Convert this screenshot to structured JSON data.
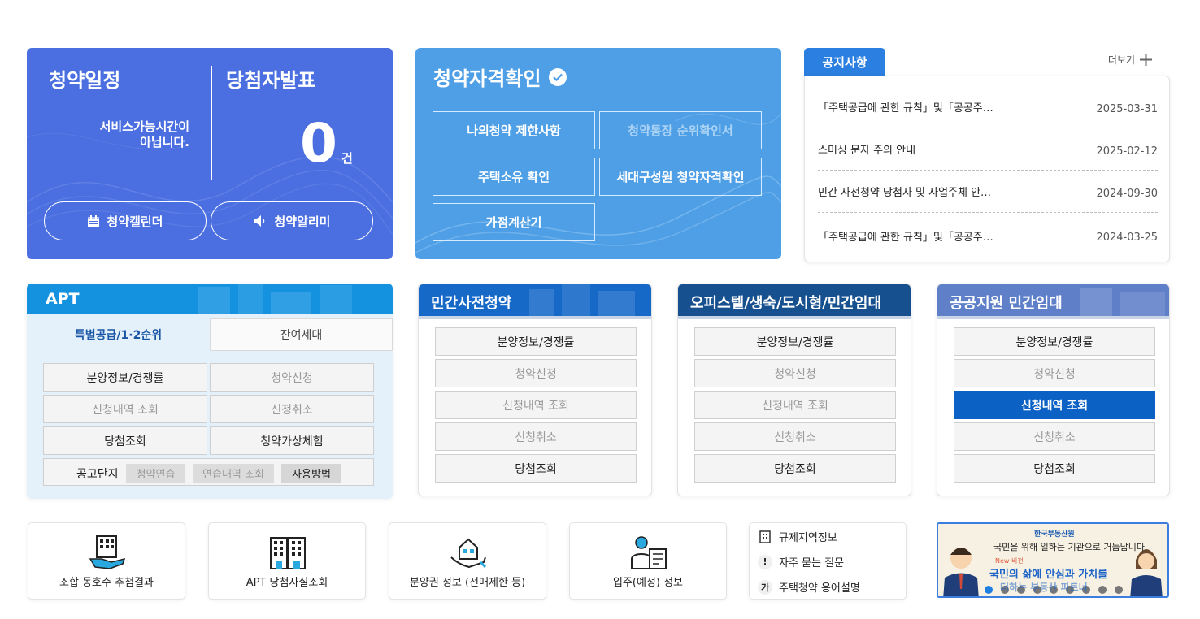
{
  "schedule": {
    "title_left": "청약일정",
    "title_right": "당첨자발표",
    "service_msg_1": "서비스가능시간이",
    "service_msg_2": "아닙니다.",
    "count": "0",
    "count_unit": "건",
    "calendar_label": "청약캘린더",
    "alarm_label": "청약알리미"
  },
  "qualification": {
    "title": "청약자격확인",
    "buttons": [
      "나의청약 제한사항",
      "청약통장 순위확인서",
      "주택소유 확인",
      "세대구성원 청약자격확인",
      "가점계산기"
    ]
  },
  "notice": {
    "tab": "공지사항",
    "more": "더보기",
    "items": [
      {
        "title": "「주택공급에 관한 규칙」및「공공주…",
        "date": "2025-03-31"
      },
      {
        "title": "스미싱 문자 주의 안내",
        "date": "2025-02-12"
      },
      {
        "title": "민간 사전청약 당첨자 및 사업주체 안…",
        "date": "2024-09-30"
      },
      {
        "title": "「주택공급에 관한 규칙」및「공공주…",
        "date": "2024-03-25"
      }
    ]
  },
  "apt": {
    "title": "APT",
    "tab_active": "특별공급/1·2순위",
    "tab_other": "잔여세대",
    "buttons": [
      "분양정보/경쟁률",
      "청약신청",
      "신청내역 조회",
      "신청취소",
      "당첨조회",
      "청약가상체험"
    ],
    "row_label": "공고단지",
    "row_buttons": [
      "청약연습",
      "연습내역 조회",
      "사용방법"
    ]
  },
  "cards": [
    {
      "title": "민간사전청약",
      "buttons": [
        "분양정보/경쟁률",
        "청약신청",
        "신청내역 조회",
        "신청취소",
        "당첨조회"
      ]
    },
    {
      "title": "오피스텔/생숙/도시형/민간임대",
      "buttons": [
        "분양정보/경쟁률",
        "청약신청",
        "신청내역 조회",
        "신청취소",
        "당첨조회"
      ]
    },
    {
      "title": "공공지원 민간임대",
      "buttons": [
        "분양정보/경쟁률",
        "청약신청",
        "신청내역 조회",
        "신청취소",
        "당첨조회"
      ]
    }
  ],
  "quick": [
    {
      "label": "조합 동호수 추첨결과",
      "icon": "building-hand-icon"
    },
    {
      "label": "APT 당첨사실조회",
      "icon": "apartment-icon"
    },
    {
      "label": "분양권 정보 (전매제한 등)",
      "icon": "house-hand-icon"
    },
    {
      "label": "입주(예정) 정보",
      "icon": "resident-icon"
    }
  ],
  "links": [
    {
      "badge": "",
      "label": "규제지역정보",
      "icon": "building-icon"
    },
    {
      "badge": "!",
      "label": "자주 묻는 질문",
      "icon": "exclamation-icon"
    },
    {
      "badge": "가",
      "label": "주택청약 용어설명",
      "icon": "glossary-icon"
    }
  ],
  "banner": {
    "logo": "한국부동산원",
    "tagline": "국민을 위해 일하는 기관으로 거듭납니다",
    "badge": "New 비전",
    "line1": "국민의 삶에 안심과 가치를",
    "line2": "더하는 부동산 파트너"
  },
  "colors": {
    "schedule_bg": "#4b6fe0",
    "qualification_bg": "#4f9fe6",
    "notice_tab": "#2a7fe0",
    "apt_head": "#1492e0",
    "active_button": "#0b62c4"
  }
}
